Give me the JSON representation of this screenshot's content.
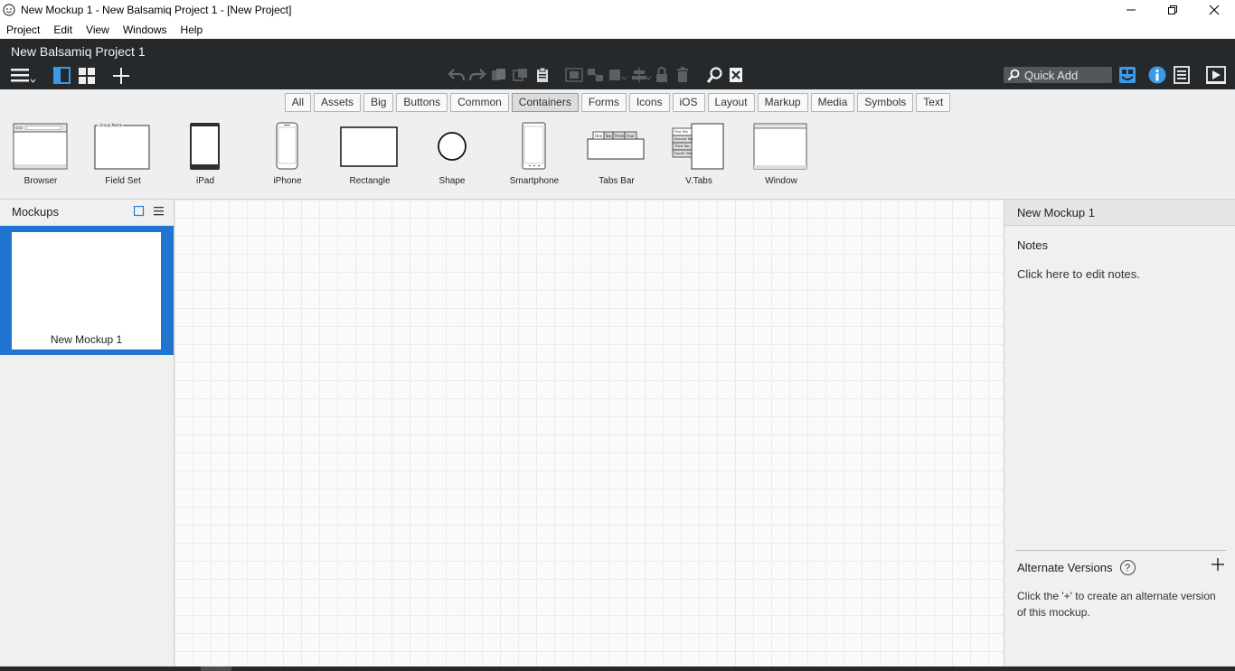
{
  "window": {
    "title": "New Mockup 1 - New Balsamiq Project 1 - [New Project]"
  },
  "menu": [
    "Project",
    "Edit",
    "View",
    "Windows",
    "Help"
  ],
  "header": {
    "project_title": "New Balsamiq Project 1",
    "quick_add_placeholder": "Quick Add"
  },
  "filters": [
    "All",
    "Assets",
    "Big",
    "Buttons",
    "Common",
    "Containers",
    "Forms",
    "Icons",
    "iOS",
    "Layout",
    "Markup",
    "Media",
    "Symbols",
    "Text"
  ],
  "active_filter": "Containers",
  "components": [
    "Browser",
    "Field Set",
    "iPad",
    "iPhone",
    "Rectangle",
    "Shape",
    "Smartphone",
    "Tabs Bar",
    "V.Tabs",
    "Window"
  ],
  "component_thumb_text": {
    "field_set_legend": "Group Name",
    "tabs": [
      "One",
      "Two",
      "Three",
      "Four"
    ],
    "vtabs": [
      "First Tab",
      "Second Tab",
      "Third Tab",
      "Fourth Tab"
    ]
  },
  "mockups_panel": {
    "title": "Mockups",
    "items": [
      {
        "label": "New Mockup 1"
      }
    ]
  },
  "properties_panel": {
    "title": "New Mockup 1",
    "notes_heading": "Notes",
    "notes_placeholder": "Click here to edit notes.",
    "alt_versions_heading": "Alternate Versions",
    "alt_versions_help": "?",
    "alt_versions_text": "Click the '+' to create an alternate version of this mockup."
  },
  "colors": {
    "header_bg": "#26292b",
    "selection_blue": "#1f75cf",
    "accent_icon_blue": "#3b9be8"
  }
}
